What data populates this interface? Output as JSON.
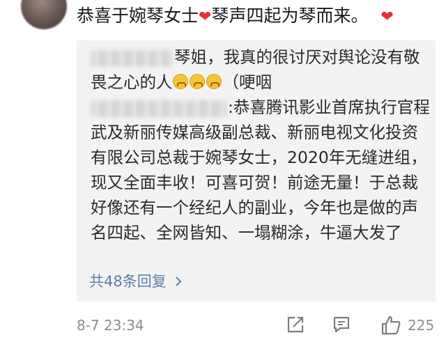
{
  "comment": {
    "text": "恭喜于婉琴女士",
    "text_tail": "琴声四起为琴而来。",
    "heart_icon": "red-heart-icon",
    "accent_color": "#e8303c"
  },
  "replies": [
    {
      "username_visible": "琴姐，",
      "text": "我真的很讨厌对舆论没有敬畏之心的人",
      "emoji_icon": "crying-emoji-icon",
      "text_tail": "（哽咽"
    },
    {
      "username_visible": ":",
      "text": "恭喜腾讯影业首席执行官程武及新丽传媒高级副总裁、新丽电视文化投资有限公司总裁于婉琴女士，2020年无缝进组，现又全面丰收！可喜可贺！前途无量！于总裁好像还有一个经纪人的副业，今年也是做的声名四起、全网皆知、一塌糊涂，牛逼大发了"
    }
  ],
  "more_replies": {
    "label": "共48条回复",
    "chevron_icon": "chevron-right-icon",
    "link_color": "#5b7ea8"
  },
  "footer": {
    "timestamp": "8-7 23:34",
    "like_count": "225",
    "icons": [
      "share-icon",
      "comment-icon",
      "thumbs-up-icon"
    ]
  }
}
